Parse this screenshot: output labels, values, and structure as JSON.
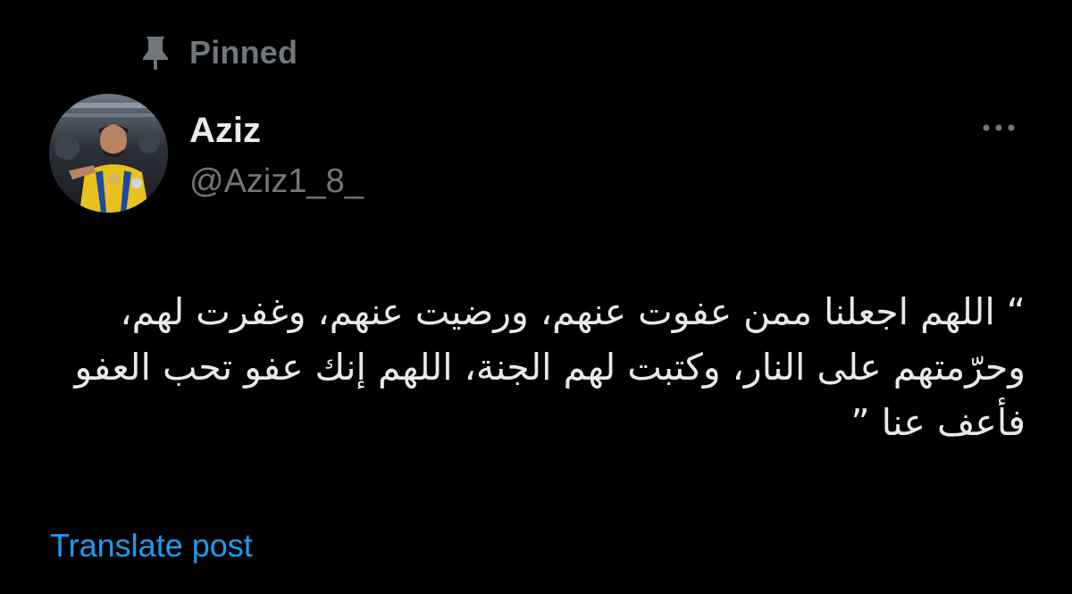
{
  "pinned": {
    "label": "Pinned",
    "icon": "pin-icon"
  },
  "author": {
    "display_name": "Aziz",
    "handle": "@Aziz1_8_",
    "avatar_icon": "avatar"
  },
  "post": {
    "text": "“ اللهم اجعلنا ممن عفوت عنهم، ورضيت عنهم، وغفرت لهم، وحرّمتهم على النار، وكتبت لهم الجنة، اللهم إنك عفو تحب العفو فأعف عنا ”",
    "direction": "rtl"
  },
  "actions": {
    "more_icon": "more-options-icon",
    "translate_label": "Translate post"
  },
  "colors": {
    "background": "#000000",
    "primary_text": "#e7e9ea",
    "secondary_text": "#71767b",
    "link": "#1d9bf0"
  }
}
